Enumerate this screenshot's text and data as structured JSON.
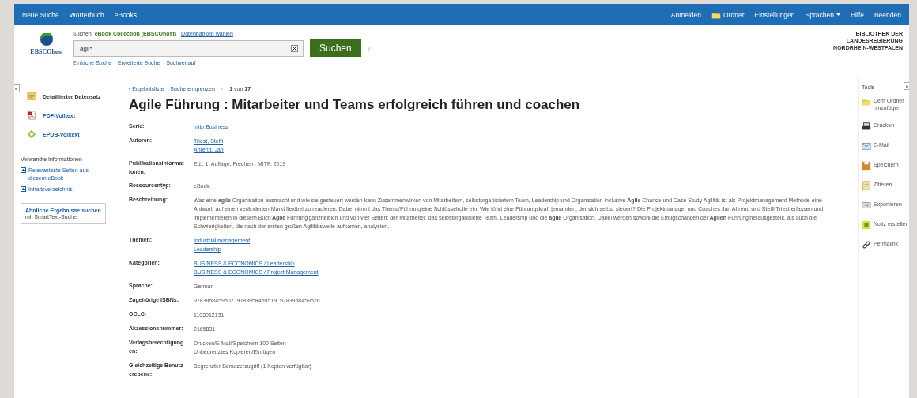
{
  "topbar": {
    "left": [
      "Neue Suche",
      "Wörterbuch",
      "eBooks"
    ],
    "right": [
      {
        "label": "Anmelden",
        "kind": "text"
      },
      {
        "label": "Ordner",
        "kind": "folder"
      },
      {
        "label": "Einstellungen",
        "kind": "text"
      },
      {
        "label": "Sprachen",
        "kind": "dropdown"
      },
      {
        "label": "Hilfe",
        "kind": "text"
      },
      {
        "label": "Beenden",
        "kind": "text"
      }
    ]
  },
  "header": {
    "logo": "EBSCOhost",
    "search_prefix": "Suchen:",
    "database": "eBook Collection (EBSCOhost)",
    "choose_db": "Datenbanken wählen",
    "query": "agil*",
    "search_button": "Suchen",
    "help": "?",
    "links": [
      "Einfache Suche",
      "Erweiterte Suche",
      "Suchverlauf"
    ],
    "institution": [
      "BIBLIOTHEK DER",
      "LANDESREGIERUNG",
      "NORDRHEIN-WESTFALEN"
    ]
  },
  "sidebar": {
    "collapse": "«",
    "items": [
      {
        "label": "Detaillierter Datensatz",
        "kind": "record",
        "selected": true
      },
      {
        "label": "PDF-Volltext",
        "kind": "pdf",
        "selected": false
      },
      {
        "label": "EPUB-Volltext",
        "kind": "epub",
        "selected": false
      }
    ],
    "related_title": "Verwandte Informationen",
    "related": [
      "Relevanteste Seiten aus diesem eBook",
      "Inhaltsverzeichnis"
    ],
    "similar": {
      "title": "Ähnliche Ergebnisse suchen",
      "note": "mit SmartText-Suche."
    }
  },
  "nav": {
    "back": "‹ Ergebnisliste",
    "refine": "Suche eingrenzen",
    "prev": "‹",
    "current": "1",
    "of": "von",
    "total": "17",
    "next": "›"
  },
  "record": {
    "title": "**Agile** Führung : Mitarbeiter und Teams erfolgreich führen und coachen",
    "fields": [
      {
        "label": "Serie:",
        "kind": "link",
        "values": [
          "mitp Business"
        ]
      },
      {
        "label": "Autoren:",
        "kind": "link",
        "values": [
          "Triest, Steffi",
          "Ahrend, Jan"
        ]
      },
      {
        "label": "Publikationsinformationen:",
        "kind": "text",
        "values": [
          "Ed.: 1. Auflage. Frechen : MITP. 2019"
        ]
      },
      {
        "label": "Ressourcentyp:",
        "kind": "text",
        "values": [
          "eBook."
        ]
      },
      {
        "label": "Beschreibung:",
        "kind": "text",
        "values": [
          "Was eine **agile** Organisation ausmacht und wie sie gesteuert werden kann Zusammenwirken von Mitarbeitern, selbstorganisiertem Team, Leadership und Organisation inklusive **Agile** Chance und Case Study Agilität ist als Projektmanagement-Methode eine Antwort, auf einen veränderten Markt flexibel zu reagieren. Dabei nimmt das Thema'Führung'eine Schlüsselrolle ein. Wie führt eine Führungskraft jemanden, der sich selbst steuert? Die Projektmanager und Coaches Jan Ahrend und Steffi Triest erfassen und implementieren in diesem Buch'**Agile** Führung'ganzheitlich und von vier Seiten: der Mitarbeiter, das selbstorganisierte Team, Leadership und die **agile** Organisation. Dabei werden sowohl die Erfolgschancen der'**Agilen** Führung'herausgestellt, als auch die Schwierigkeiten, die nach der ersten großen Agilitätswelle aufkamen, analysiert."
        ]
      },
      {
        "label": "Themen:",
        "kind": "link",
        "values": [
          "Industrial management",
          "Leadership"
        ]
      },
      {
        "label": "Kategorien:",
        "kind": "link",
        "values": [
          "BUSINESS & ECONOMICS / Leadership",
          "BUSINESS & ECONOMICS / Project Management"
        ]
      },
      {
        "label": "Sprache:",
        "kind": "text",
        "values": [
          "German"
        ]
      },
      {
        "label": "Zugehörige ISBNs:",
        "kind": "text",
        "values": [
          "9783958459502. 9783958459519. 9783958459526."
        ]
      },
      {
        "label": "OCLC:",
        "kind": "text",
        "values": [
          "1105012131"
        ]
      },
      {
        "label": "Akzessionsnummer:",
        "kind": "text",
        "values": [
          "2165831"
        ]
      },
      {
        "label": "Verlagsberechtigungen:",
        "kind": "text",
        "values": [
          "Drucken/E-Mail/Speichern 100 Seiten",
          "Unbegrenztes Kopieren/Einfügen"
        ]
      },
      {
        "label": "Gleichzeitige Benutzerebene:",
        "kind": "text",
        "values": [
          "Begrenzter Benutzerzugriff (1 Kopien verfügbar)"
        ]
      }
    ]
  },
  "tools": {
    "title": "Tools",
    "expand": "»",
    "items": [
      {
        "label": "Dem Ordner hinzufügen",
        "kind": "folder"
      },
      {
        "label": "Drucken",
        "kind": "print"
      },
      {
        "label": "E-Mail",
        "kind": "email"
      },
      {
        "label": "Speichern",
        "kind": "save"
      },
      {
        "label": "Zitieren",
        "kind": "cite"
      },
      {
        "label": "Exportieren",
        "kind": "export"
      },
      {
        "label": "Notiz erstellen",
        "kind": "note"
      },
      {
        "label": "Permalink",
        "kind": "link"
      }
    ]
  }
}
